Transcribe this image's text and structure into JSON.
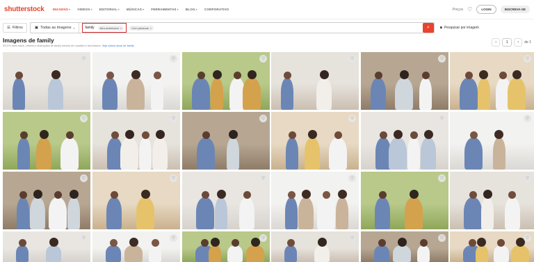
{
  "header": {
    "logo": "shutterstock",
    "nav": [
      {
        "label": "IMAGENS",
        "active": true
      },
      {
        "label": "VÍDEOS",
        "active": false
      },
      {
        "label": "EDITORIAL",
        "active": false
      },
      {
        "label": "MÚSICAS",
        "active": false
      },
      {
        "label": "FERRAMENTAS",
        "active": false
      },
      {
        "label": "BLOG",
        "active": false
      },
      {
        "label": "CORPORATIVO",
        "active": false
      }
    ],
    "pricing": "Preços",
    "login": "LOGIN",
    "signup": "INSCREVA-SE"
  },
  "search": {
    "filters_label": "Filtros",
    "scope_label": "Todas as imagens",
    "query": "family",
    "chip_1": "Afro-americano",
    "chip_2": "Com pessoas",
    "image_search_label": "Pesquisar por imagem"
  },
  "results": {
    "title": "Imagens de family",
    "subtitle": "93.974 fotos stock, vetores e ilustrações de family isentos de royalties e licenciados.",
    "subtitle_link": "Veja vídeos stock de family",
    "page": "1",
    "page_of": "de 1"
  },
  "icons": {
    "heart": "heart-icon",
    "filter": "sliders-icon",
    "image": "image-icon",
    "search": "search-icon",
    "camera": "camera-icon"
  },
  "colors": {
    "brand": "#e8432e",
    "highlight_border": "#d62b2b"
  }
}
